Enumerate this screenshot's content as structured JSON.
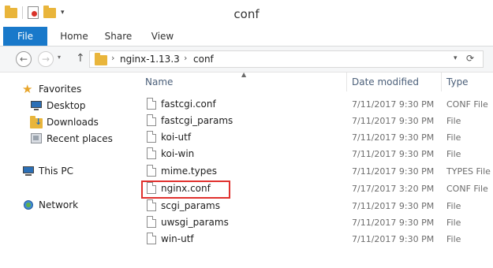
{
  "window": {
    "title": "conf"
  },
  "ribbon": {
    "tabs": [
      "File",
      "Home",
      "Share",
      "View"
    ]
  },
  "address": {
    "segments": [
      "nginx-1.13.3",
      "conf"
    ],
    "separator": "›"
  },
  "nav": {
    "favorites": "Favorites",
    "items": [
      "Desktop",
      "Downloads",
      "Recent places"
    ],
    "this_pc": "This PC",
    "network": "Network"
  },
  "columns": {
    "name": "Name",
    "date": "Date modified",
    "type": "Type"
  },
  "files": [
    {
      "name": "fastcgi.conf",
      "date": "7/11/2017 9:30 PM",
      "type": "CONF File"
    },
    {
      "name": "fastcgi_params",
      "date": "7/11/2017 9:30 PM",
      "type": "File"
    },
    {
      "name": "koi-utf",
      "date": "7/11/2017 9:30 PM",
      "type": "File"
    },
    {
      "name": "koi-win",
      "date": "7/11/2017 9:30 PM",
      "type": "File"
    },
    {
      "name": "mime.types",
      "date": "7/11/2017 9:30 PM",
      "type": "TYPES File"
    },
    {
      "name": "nginx.conf",
      "date": "7/17/2017 3:20 PM",
      "type": "CONF File"
    },
    {
      "name": "scgi_params",
      "date": "7/11/2017 9:30 PM",
      "type": "File"
    },
    {
      "name": "uwsgi_params",
      "date": "7/11/2017 9:30 PM",
      "type": "File"
    },
    {
      "name": "win-utf",
      "date": "7/11/2017 9:30 PM",
      "type": "File"
    }
  ],
  "colors": {
    "file_tab": "#1979ca",
    "highlight": "#e0312e",
    "folder": "#e9b53b"
  },
  "icons": [
    "back-arrow-icon",
    "forward-arrow-icon",
    "up-arrow-icon",
    "folder-icon",
    "refresh-icon",
    "star-icon",
    "desktop-icon",
    "downloads-icon",
    "recent-places-icon",
    "computer-icon",
    "network-icon",
    "file-icon"
  ]
}
